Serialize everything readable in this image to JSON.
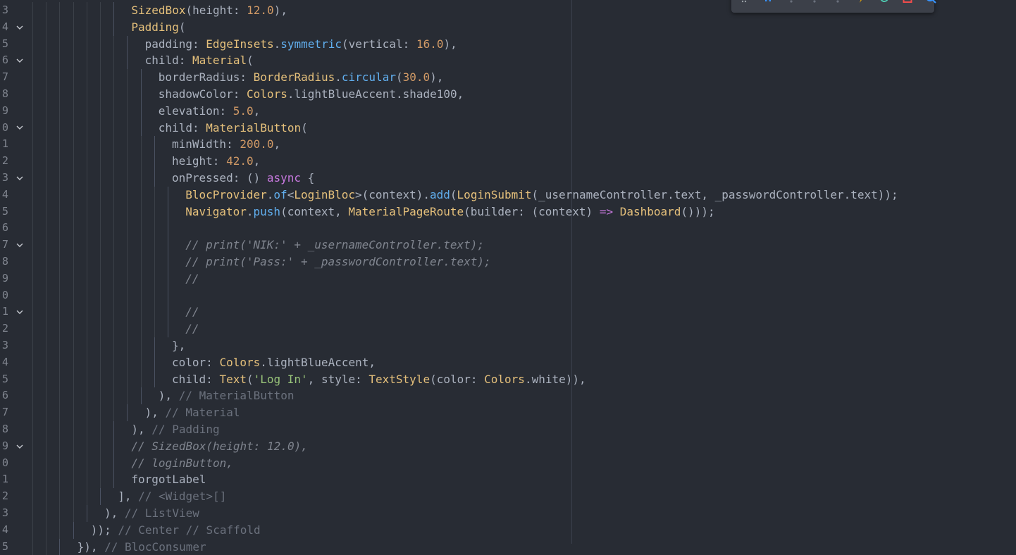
{
  "editor": {
    "lines": [
      {
        "no": "3",
        "fold": false,
        "indent": 7,
        "tokens": [
          [
            "t-type",
            "SizedBox"
          ],
          [
            "t-prop",
            "(height: "
          ],
          [
            "t-num",
            "12.0"
          ],
          [
            "t-prop",
            "),"
          ]
        ]
      },
      {
        "no": "4",
        "fold": true,
        "indent": 7,
        "tokens": [
          [
            "t-type",
            "Padding"
          ],
          [
            "t-prop",
            "("
          ]
        ]
      },
      {
        "no": "5",
        "fold": false,
        "indent": 8,
        "tokens": [
          [
            "t-prop",
            "padding: "
          ],
          [
            "t-type",
            "EdgeInsets"
          ],
          [
            "t-prop",
            "."
          ],
          [
            "t-fn",
            "symmetric"
          ],
          [
            "t-prop",
            "(vertical: "
          ],
          [
            "t-num",
            "16.0"
          ],
          [
            "t-prop",
            "),"
          ]
        ]
      },
      {
        "no": "6",
        "fold": true,
        "indent": 8,
        "tokens": [
          [
            "t-prop",
            "child: "
          ],
          [
            "t-type",
            "Material"
          ],
          [
            "t-prop",
            "("
          ]
        ]
      },
      {
        "no": "7",
        "fold": false,
        "indent": 9,
        "tokens": [
          [
            "t-prop",
            "borderRadius: "
          ],
          [
            "t-type",
            "BorderRadius"
          ],
          [
            "t-prop",
            "."
          ],
          [
            "t-fn",
            "circular"
          ],
          [
            "t-prop",
            "("
          ],
          [
            "t-num",
            "30.0"
          ],
          [
            "t-prop",
            "),"
          ]
        ]
      },
      {
        "no": "8",
        "fold": false,
        "indent": 9,
        "tokens": [
          [
            "t-prop",
            "shadowColor: "
          ],
          [
            "t-type",
            "Colors"
          ],
          [
            "t-prop",
            ".lightBlueAccent.shade100,"
          ]
        ]
      },
      {
        "no": "9",
        "fold": false,
        "indent": 9,
        "tokens": [
          [
            "t-prop",
            "elevation: "
          ],
          [
            "t-num",
            "5.0"
          ],
          [
            "t-prop",
            ","
          ]
        ]
      },
      {
        "no": "0",
        "fold": true,
        "indent": 9,
        "tokens": [
          [
            "t-prop",
            "child: "
          ],
          [
            "t-type",
            "MaterialButton"
          ],
          [
            "t-prop",
            "("
          ]
        ]
      },
      {
        "no": "1",
        "fold": false,
        "indent": 10,
        "tokens": [
          [
            "t-prop",
            "minWidth: "
          ],
          [
            "t-num",
            "200.0"
          ],
          [
            "t-prop",
            ","
          ]
        ]
      },
      {
        "no": "2",
        "fold": false,
        "indent": 10,
        "tokens": [
          [
            "t-prop",
            "height: "
          ],
          [
            "t-num",
            "42.0"
          ],
          [
            "t-prop",
            ","
          ]
        ]
      },
      {
        "no": "3",
        "fold": true,
        "indent": 10,
        "tokens": [
          [
            "t-prop",
            "onPressed: () "
          ],
          [
            "t-kw",
            "async"
          ],
          [
            "t-prop",
            " {"
          ]
        ]
      },
      {
        "no": "4",
        "fold": false,
        "indent": 11,
        "tokens": [
          [
            "t-type",
            "BlocProvider"
          ],
          [
            "t-prop",
            "."
          ],
          [
            "t-fn",
            "of"
          ],
          [
            "t-prop",
            "<"
          ],
          [
            "t-type",
            "LoginBloc"
          ],
          [
            "t-prop",
            ">(context)."
          ],
          [
            "t-fn",
            "add"
          ],
          [
            "t-prop",
            "("
          ],
          [
            "t-type",
            "LoginSubmit"
          ],
          [
            "t-prop",
            "(_usernameController.text, _passwordController.text));"
          ]
        ]
      },
      {
        "no": "5",
        "fold": false,
        "indent": 11,
        "tokens": [
          [
            "t-type",
            "Navigator"
          ],
          [
            "t-prop",
            "."
          ],
          [
            "t-fn",
            "push"
          ],
          [
            "t-prop",
            "(context, "
          ],
          [
            "t-type",
            "MaterialPageRoute"
          ],
          [
            "t-prop",
            "(builder: (context) "
          ],
          [
            "t-kw",
            "=>"
          ],
          [
            "t-prop",
            " "
          ],
          [
            "t-type",
            "Dashboard"
          ],
          [
            "t-prop",
            "()));"
          ]
        ]
      },
      {
        "no": "6",
        "fold": false,
        "indent": 11,
        "tokens": []
      },
      {
        "no": "7",
        "fold": true,
        "indent": 11,
        "tokens": [
          [
            "t-com",
            "// print('NIK:' + _usernameController.text);"
          ]
        ]
      },
      {
        "no": "8",
        "fold": false,
        "indent": 11,
        "tokens": [
          [
            "t-com",
            "// print('Pass:' + _passwordController.text);"
          ]
        ]
      },
      {
        "no": "9",
        "fold": false,
        "indent": 11,
        "tokens": [
          [
            "t-com",
            "//"
          ]
        ]
      },
      {
        "no": "0",
        "fold": false,
        "indent": 11,
        "tokens": []
      },
      {
        "no": "1",
        "fold": true,
        "indent": 11,
        "tokens": [
          [
            "t-com",
            "//"
          ]
        ]
      },
      {
        "no": "2",
        "fold": false,
        "indent": 11,
        "tokens": [
          [
            "t-com",
            "//"
          ]
        ]
      },
      {
        "no": "3",
        "fold": false,
        "indent": 10,
        "tokens": [
          [
            "t-prop",
            "},"
          ]
        ]
      },
      {
        "no": "4",
        "fold": false,
        "indent": 10,
        "tokens": [
          [
            "t-prop",
            "color: "
          ],
          [
            "t-type",
            "Colors"
          ],
          [
            "t-prop",
            ".lightBlueAccent,"
          ]
        ]
      },
      {
        "no": "5",
        "fold": false,
        "indent": 10,
        "tokens": [
          [
            "t-prop",
            "child: "
          ],
          [
            "t-type",
            "Text"
          ],
          [
            "t-prop",
            "("
          ],
          [
            "t-str",
            "'Log In'"
          ],
          [
            "t-prop",
            ", style: "
          ],
          [
            "t-type",
            "TextStyle"
          ],
          [
            "t-prop",
            "(color: "
          ],
          [
            "t-type",
            "Colors"
          ],
          [
            "t-prop",
            ".white)),"
          ]
        ]
      },
      {
        "no": "6",
        "fold": false,
        "indent": 9,
        "tokens": [
          [
            "t-prop",
            "), "
          ],
          [
            "t-tag",
            "// MaterialButton"
          ]
        ]
      },
      {
        "no": "7",
        "fold": false,
        "indent": 8,
        "tokens": [
          [
            "t-prop",
            "), "
          ],
          [
            "t-tag",
            "// Material"
          ]
        ]
      },
      {
        "no": "8",
        "fold": false,
        "indent": 7,
        "tokens": [
          [
            "t-prop",
            "), "
          ],
          [
            "t-tag",
            "// Padding"
          ]
        ]
      },
      {
        "no": "9",
        "fold": true,
        "indent": 7,
        "tokens": [
          [
            "t-com",
            "// SizedBox(height: 12.0),"
          ]
        ]
      },
      {
        "no": "0",
        "fold": false,
        "indent": 7,
        "tokens": [
          [
            "t-com",
            "// loginButton,"
          ]
        ]
      },
      {
        "no": "1",
        "fold": false,
        "indent": 7,
        "tokens": [
          [
            "t-prop",
            "forgotLabel"
          ]
        ]
      },
      {
        "no": "2",
        "fold": false,
        "indent": 6,
        "tokens": [
          [
            "t-prop",
            "], "
          ],
          [
            "t-tag",
            "// <Widget>[]"
          ]
        ]
      },
      {
        "no": "3",
        "fold": false,
        "indent": 5,
        "tokens": [
          [
            "t-prop",
            "), "
          ],
          [
            "t-tag",
            "// ListView"
          ]
        ]
      },
      {
        "no": "4",
        "fold": false,
        "indent": 4,
        "tokens": [
          [
            "t-prop",
            ")); "
          ],
          [
            "t-tag",
            "// Center // Scaffold"
          ]
        ]
      },
      {
        "no": "5",
        "fold": false,
        "indent": 3,
        "tokens": [
          [
            "t-prop",
            "}), "
          ],
          [
            "t-tag",
            "// BlocConsumer"
          ]
        ]
      }
    ]
  },
  "debug_toolbar": {
    "buttons": [
      {
        "name": "drag-handle-icon"
      },
      {
        "name": "pause-icon"
      },
      {
        "name": "step-over-icon"
      },
      {
        "name": "step-into-icon"
      },
      {
        "name": "step-out-icon"
      },
      {
        "name": "hot-reload-icon"
      },
      {
        "name": "restart-icon"
      },
      {
        "name": "stop-icon"
      },
      {
        "name": "open-devtools-icon"
      }
    ],
    "colors": {
      "hot_reload": "#e5a50a",
      "restart": "#4ec9b0",
      "stop": "#f14c4c",
      "devtools": "#3794ff"
    }
  }
}
